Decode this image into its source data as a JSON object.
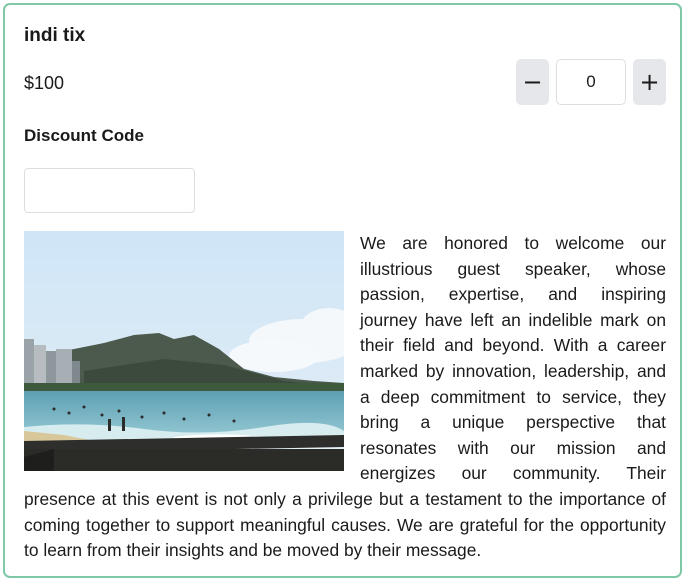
{
  "ticket": {
    "name": "indi tix",
    "price": "$100",
    "quantity": "0",
    "decrement_symbol": "−",
    "increment_symbol": "+"
  },
  "discount": {
    "label": "Discount Code",
    "value": "",
    "placeholder": ""
  },
  "description": {
    "text": "We are honored to welcome our illustrious guest speaker, whose passion, expertise, and inspiring journey have left an indelible mark on their field and beyond. With a career marked by innovation, leadership, and a deep commitment to service, they bring a unique perspective that resonates with our mission and energizes our community. Their presence at this event is not only a privilege but a testament to the importance of coming together to support meaningful causes. We are grateful for the opportunity to learn from their insights and be moved by their message."
  },
  "colors": {
    "card_border": "#7ec8a5",
    "stepper_button_bg": "#e6e7ea",
    "input_border": "#dcdee2"
  },
  "icons": {
    "decrement": "minus-icon",
    "increment": "plus-icon"
  }
}
